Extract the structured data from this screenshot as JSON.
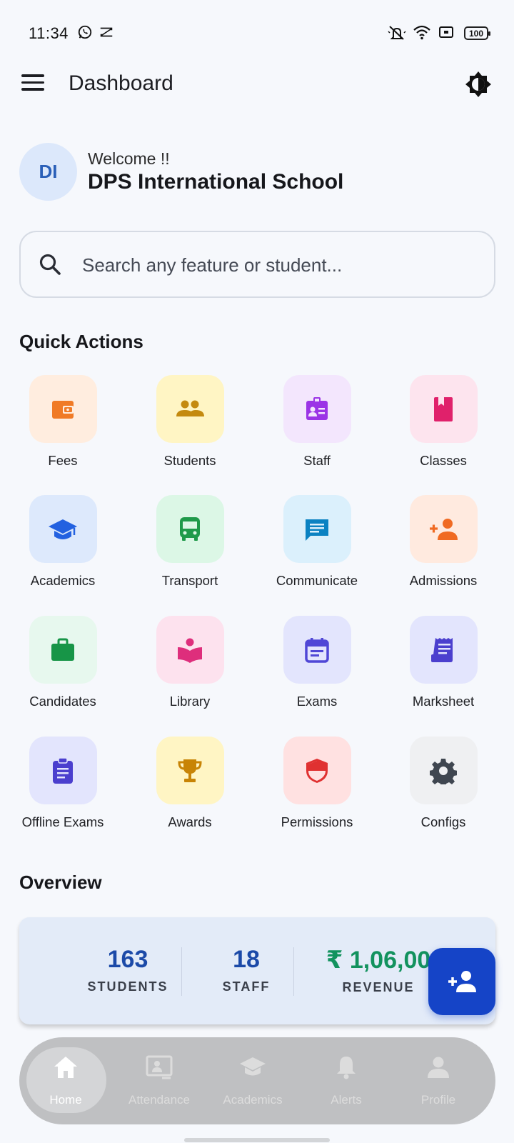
{
  "status_bar": {
    "time": "11:34",
    "battery": "100",
    "icons": [
      "whatsapp-icon",
      "capcut-icon",
      "mute-icon",
      "wifi-icon",
      "screen-icon",
      "battery-icon"
    ]
  },
  "app_bar": {
    "title": "Dashboard",
    "menu_icon": "hamburger-menu-icon",
    "theme_icon": "theme-toggle-icon"
  },
  "welcome": {
    "avatar_initials": "DI",
    "greeting": "Welcome !!",
    "school_name": "DPS International School"
  },
  "search": {
    "placeholder": "Search any feature or student..."
  },
  "quick_actions": {
    "title": "Quick Actions",
    "items": [
      {
        "label": "Fees",
        "icon": "wallet-icon",
        "bg": "#ffeddf",
        "color": "#f07a25"
      },
      {
        "label": "Students",
        "icon": "people-icon",
        "bg": "#fff5c4",
        "color": "#c48a10"
      },
      {
        "label": "Staff",
        "icon": "id-badge-icon",
        "bg": "#f3e6fd",
        "color": "#9b34e6"
      },
      {
        "label": "Classes",
        "icon": "book-icon",
        "bg": "#fde4ee",
        "color": "#e0216b"
      },
      {
        "label": "Academics",
        "icon": "graduation-cap-icon",
        "bg": "#dde9fc",
        "color": "#2361e0"
      },
      {
        "label": "Transport",
        "icon": "bus-icon",
        "bg": "#dcf7e6",
        "color": "#1f9a4a"
      },
      {
        "label": "Communicate",
        "icon": "chat-icon",
        "bg": "#dbf0fc",
        "color": "#0b82c2"
      },
      {
        "label": "Admissions",
        "icon": "person-add-icon",
        "bg": "#ffeadf",
        "color": "#f06a22"
      },
      {
        "label": "Candidates",
        "icon": "briefcase-icon",
        "bg": "#e7f8ee",
        "color": "#179547"
      },
      {
        "label": "Library",
        "icon": "reading-book-icon",
        "bg": "#fde2ee",
        "color": "#de2e7c"
      },
      {
        "label": "Exams",
        "icon": "calendar-icon",
        "bg": "#e3e5fd",
        "color": "#5047d6"
      },
      {
        "label": "Marksheet",
        "icon": "receipt-icon",
        "bg": "#e3e5fd",
        "color": "#4b3fce"
      },
      {
        "label": "Offline Exams",
        "icon": "clipboard-icon",
        "bg": "#e3e5fd",
        "color": "#4b3fce"
      },
      {
        "label": "Awards",
        "icon": "trophy-icon",
        "bg": "#fff5c4",
        "color": "#c88406"
      },
      {
        "label": "Permissions",
        "icon": "shield-icon",
        "bg": "#ffe1e1",
        "color": "#e03131"
      },
      {
        "label": "Configs",
        "icon": "gear-icon",
        "bg": "#eff0f2",
        "color": "#3f4650"
      }
    ]
  },
  "overview": {
    "title": "Overview",
    "stats": [
      {
        "value": "163",
        "label": "STUDENTS",
        "color": "#1c4aa8"
      },
      {
        "value": "18",
        "label": "STAFF",
        "color": "#1c4aa8"
      },
      {
        "value": "₹ 1,06,00",
        "label": "REVENUE",
        "color": "#12925e"
      }
    ]
  },
  "fab": {
    "icon": "person-add-icon",
    "color": "#1544c7"
  },
  "bottom_nav": {
    "items": [
      {
        "label": "Home",
        "icon": "home-icon",
        "active": true
      },
      {
        "label": "Attendance",
        "icon": "attendance-icon",
        "active": false
      },
      {
        "label": "Academics",
        "icon": "graduation-cap-icon",
        "active": false
      },
      {
        "label": "Alerts",
        "icon": "bell-icon",
        "active": false
      },
      {
        "label": "Profile",
        "icon": "person-icon",
        "active": false
      }
    ]
  }
}
